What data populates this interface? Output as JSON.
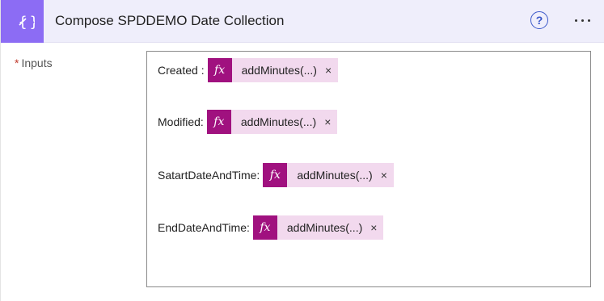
{
  "header": {
    "title": "Compose SPDDEMO Date Collection",
    "action_icon": "braces-icon",
    "help_glyph": "?",
    "accent_color": "#8c6cf4"
  },
  "inputs": {
    "label": "Inputs",
    "required_marker": "*",
    "rows": [
      {
        "label": "Created :",
        "token_icon": "fx",
        "token_text": "addMinutes(...)",
        "close": "×"
      },
      {
        "label": "Modified:",
        "token_icon": "fx",
        "token_text": "addMinutes(...)",
        "close": "×"
      },
      {
        "label": "SatartDateAndTime:",
        "token_icon": "fx",
        "token_text": "addMinutes(...)",
        "close": "×"
      },
      {
        "label": "EndDateAndTime:",
        "token_icon": "fx",
        "token_text": "addMinutes(...)",
        "close": "×"
      }
    ]
  }
}
